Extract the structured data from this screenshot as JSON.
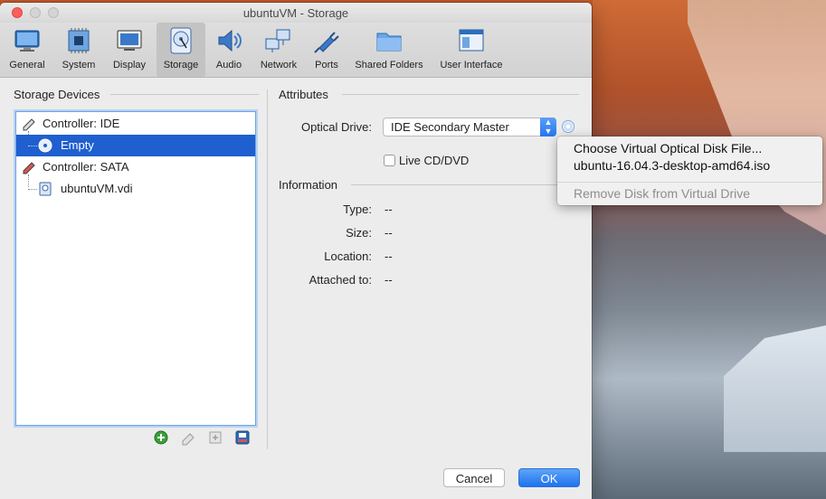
{
  "window": {
    "title": "ubuntuVM - Storage"
  },
  "toolbar": {
    "items": [
      {
        "label": "General"
      },
      {
        "label": "System"
      },
      {
        "label": "Display"
      },
      {
        "label": "Storage"
      },
      {
        "label": "Audio"
      },
      {
        "label": "Network"
      },
      {
        "label": "Ports"
      },
      {
        "label": "Shared Folders"
      },
      {
        "label": "User Interface"
      }
    ],
    "selected": "Storage"
  },
  "storage_devices": {
    "title": "Storage Devices",
    "tree": [
      {
        "label": "Controller: IDE",
        "icon": "ide-controller-icon"
      },
      {
        "label": "Empty",
        "icon": "optical-disc-icon",
        "selected": true
      },
      {
        "label": "Controller: SATA",
        "icon": "sata-controller-icon"
      },
      {
        "label": "ubuntuVM.vdi",
        "icon": "hard-disk-icon"
      }
    ],
    "actions": [
      "add-attachment-icon",
      "remove-attachment-icon",
      "add-controller-icon",
      "remove-controller-icon"
    ]
  },
  "attributes": {
    "title": "Attributes",
    "optical_drive_label": "Optical Drive:",
    "optical_drive_value": "IDE Secondary Master",
    "live_cd_label": "Live CD/DVD",
    "live_cd_checked": false
  },
  "information": {
    "title": "Information",
    "rows": [
      {
        "label": "Type:",
        "value": "--"
      },
      {
        "label": "Size:",
        "value": "--"
      },
      {
        "label": "Location:",
        "value": "--"
      },
      {
        "label": "Attached to:",
        "value": "--"
      }
    ]
  },
  "popup": {
    "items": [
      {
        "label": "Choose Virtual Optical Disk File...",
        "enabled": true
      },
      {
        "label": "ubuntu-16.04.3-desktop-amd64.iso",
        "enabled": true
      },
      {
        "label": "Remove Disk from Virtual Drive",
        "enabled": false
      }
    ]
  },
  "buttons": {
    "cancel": "Cancel",
    "ok": "OK"
  },
  "colors": {
    "accent": "#1f5fcf",
    "ok_button": "#2476ee",
    "close": "#fc5f57"
  }
}
